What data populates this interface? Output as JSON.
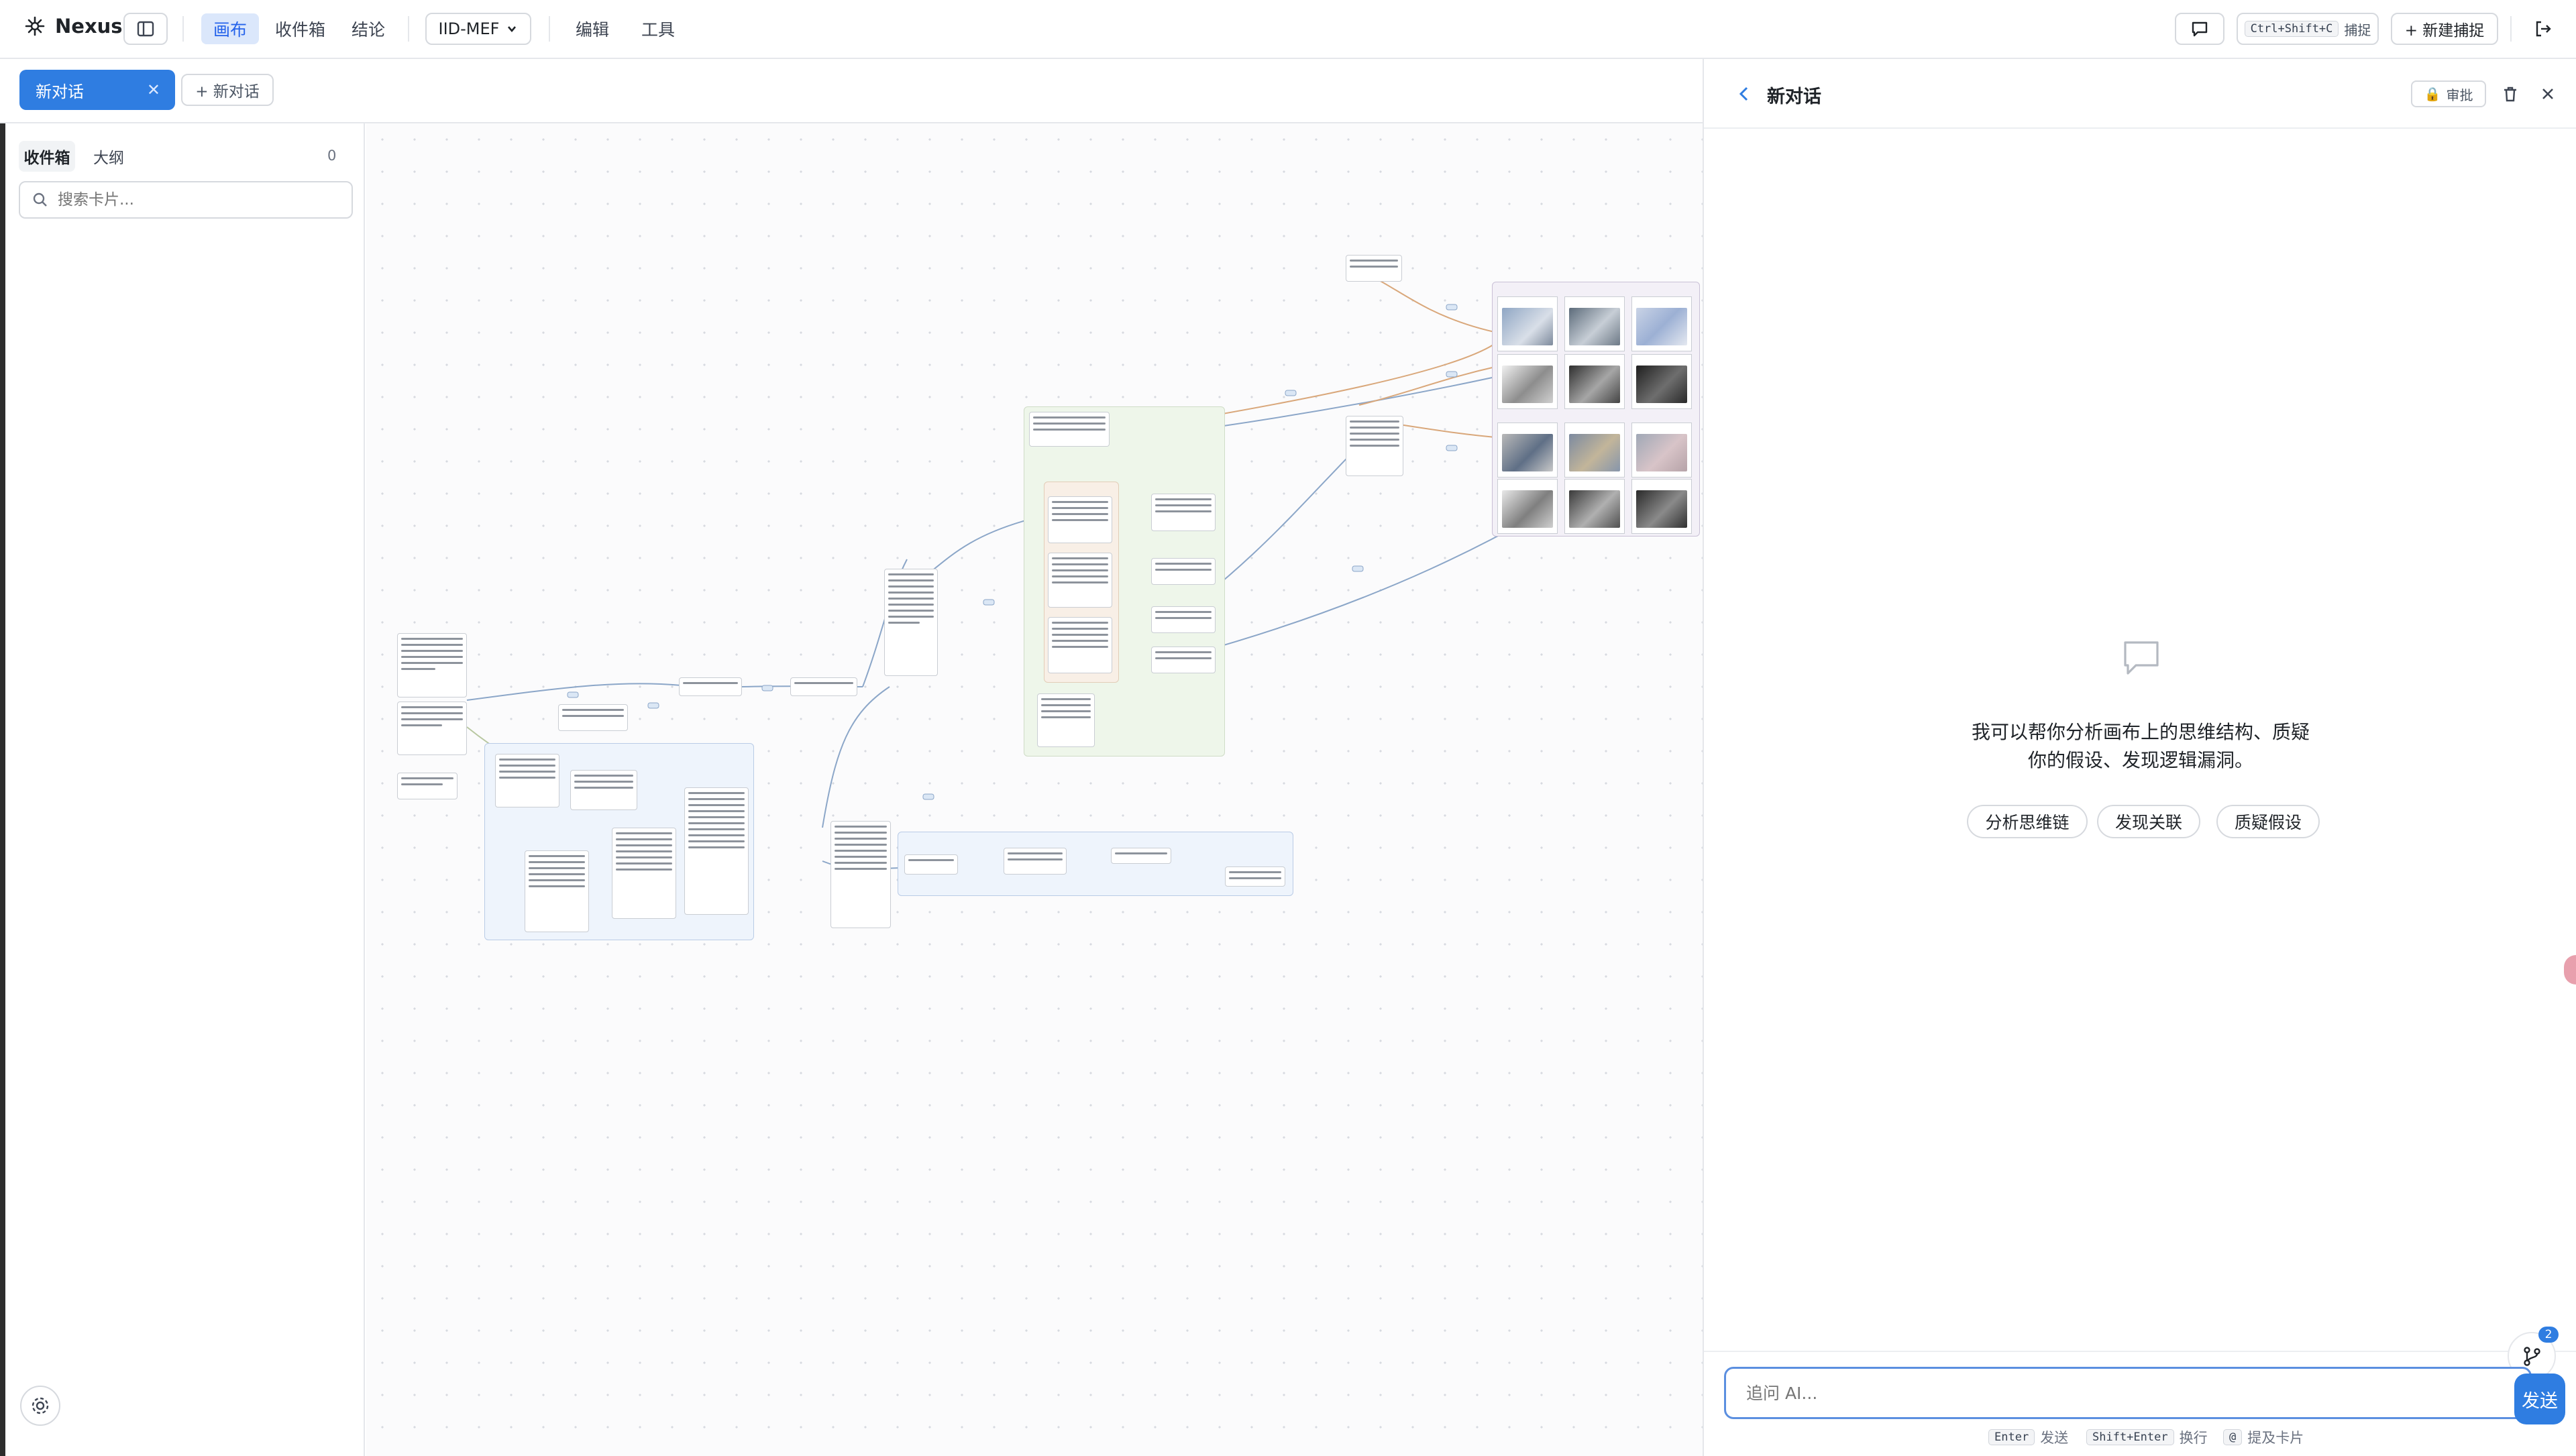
{
  "app": {
    "name": "Nexus"
  },
  "nav": {
    "items": [
      "画布",
      "收件箱",
      "结论"
    ],
    "active": "画布"
  },
  "project": {
    "name": "IID-MEF"
  },
  "menu": {
    "edit": "编辑",
    "tools": "工具"
  },
  "topbar_right": {
    "capture_shortcut": "Ctrl+Shift+C",
    "capture_label": "捕捉",
    "new_capture": "+ 新建捕捉"
  },
  "tabs": {
    "active_label": "新对话",
    "new_label": "+ 新对话"
  },
  "sidebar": {
    "tabs": [
      "收件箱",
      "大纲"
    ],
    "count": "0",
    "search_placeholder": "搜索卡片..."
  },
  "chat": {
    "title": "新对话",
    "lock_label": "审批",
    "empty_line1": "我可以帮你分析画布上的思维结构、质疑",
    "empty_line2": "你的假设、发现逻辑漏洞。",
    "suggestions": [
      "分析思维链",
      "发现关联",
      "质疑假设"
    ],
    "input_placeholder": "追问 AI...",
    "send_label": "发送",
    "branch_badge": "2",
    "hints": {
      "enter_key": "Enter",
      "enter_label": "发送",
      "shift_key": "Shift+Enter",
      "shift_label": "换行",
      "at_key": "@",
      "at_label": "提及卡片"
    }
  },
  "colors": {
    "accent": "#2f7de1",
    "nav_active_bg": "#dbe7fb",
    "group_green": "#eef6ea",
    "group_blue": "#eef4fc"
  }
}
